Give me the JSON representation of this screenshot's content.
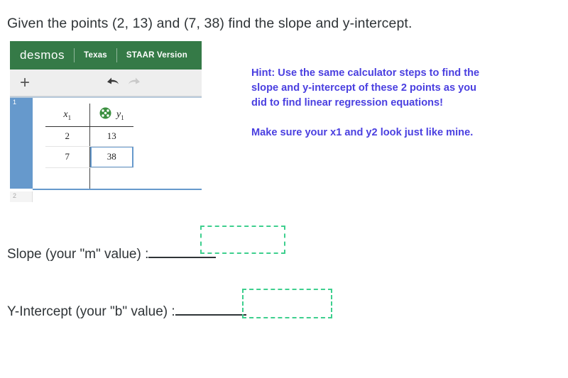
{
  "question": {
    "title": "Given the points (2, 13) and (7, 38) find the slope and y-intercept."
  },
  "calculator": {
    "header": {
      "brand": "desmos",
      "region": "Texas",
      "version": "STAAR Version"
    },
    "toolbar": {
      "add_label": "+",
      "undo_icon": "undo-arrow-icon",
      "redo_icon": "redo-arrow-icon"
    },
    "expression": {
      "row_number_1": "1",
      "row_number_2": "2"
    },
    "table": {
      "headers": [
        "x",
        "y"
      ],
      "header_subscripts": [
        "1",
        "1"
      ],
      "point_style_icon": "green-dot-style-icon",
      "rows": [
        {
          "x": "2",
          "y": "13",
          "y_selected": false
        },
        {
          "x": "7",
          "y": "38",
          "y_selected": true
        }
      ]
    },
    "colors": {
      "header_green": "#357a47",
      "selection_blue": "#6699cc",
      "point_green": "#3a8f3f"
    }
  },
  "hint": {
    "line1": "Hint: Use the same calculator steps to find the",
    "line2": "slope and y-intercept of these 2 points as you",
    "line3": "did to find linear regression equations!",
    "line4": "Make sure your x1 and y2 look just like mine.",
    "color": "#4a3fe0"
  },
  "answers": {
    "slope": {
      "label": "Slope (your \"m\" value) :",
      "value": ""
    },
    "y_intercept": {
      "label": "Y-Intercept (your \"b\" value) :",
      "value": ""
    },
    "box_color": "#3ecf8e"
  }
}
